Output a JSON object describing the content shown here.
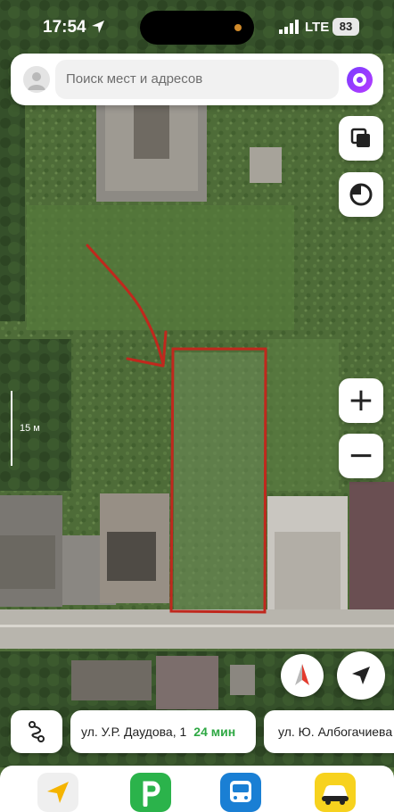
{
  "status_bar": {
    "time": "17:54",
    "network": "LTE",
    "battery": "83"
  },
  "search": {
    "placeholder": "Поиск мест и адресов"
  },
  "map": {
    "scale_label": "15 м",
    "annotation": "red-hand-drawn-arrow-and-rectangle",
    "colors": {
      "annotation": "#c0281d",
      "grass": "#4c6b37"
    }
  },
  "controls": {
    "zoom_in": "+",
    "zoom_out": "−",
    "layers_icon": "layers-icon",
    "style_icon": "map-style-icon",
    "compass_icon": "compass-icon",
    "locate_icon": "my-location-icon"
  },
  "suggestions": [
    {
      "label": "ул. У.Р. Даудова, 1",
      "time": "24 мин"
    },
    {
      "label": "ул. Ю. Албогачиева"
    }
  ],
  "dock": {
    "apps": [
      "navigator-icon",
      "parking-icon",
      "transport-icon",
      "taxi-icon"
    ]
  }
}
